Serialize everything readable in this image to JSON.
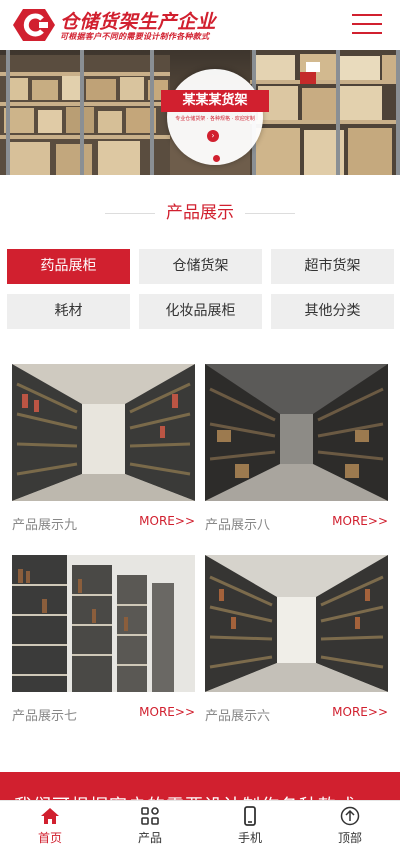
{
  "header": {
    "logo_title": "仓储货架生产企业",
    "logo_subtitle": "可根据客户不同的需要设计制作各种款式",
    "menu_icon": "hamburger-menu-icon"
  },
  "banner": {
    "title": "某某某货架",
    "tagline": "专业仓储货架 · 各种规格 · 欢迎定制",
    "arrow_icon": "chevron-right-circle-icon"
  },
  "section": {
    "title": "产品展示"
  },
  "categories": [
    {
      "label": "药品展柜",
      "active": true
    },
    {
      "label": "仓储货架",
      "active": false
    },
    {
      "label": "超市货架",
      "active": false
    },
    {
      "label": "耗材",
      "active": false
    },
    {
      "label": "化妆品展柜",
      "active": false
    },
    {
      "label": "其他分类",
      "active": false
    }
  ],
  "products": [
    {
      "name": "产品展示九",
      "more": "MORE>>"
    },
    {
      "name": "产品展示八",
      "more": "MORE>>"
    },
    {
      "name": "产品展示七",
      "more": "MORE>>"
    },
    {
      "name": "产品展示六",
      "more": "MORE>>"
    }
  ],
  "strip": {
    "text": "我们可根据客户的需要设计制作各种款式"
  },
  "nav": [
    {
      "label": "首页",
      "icon": "home-icon",
      "active": true
    },
    {
      "label": "产品",
      "icon": "grid-icon",
      "active": false
    },
    {
      "label": "手机",
      "icon": "phone-icon",
      "active": false
    },
    {
      "label": "顶部",
      "icon": "arrow-up-icon",
      "active": false
    }
  ],
  "colors": {
    "accent": "#d1202f",
    "button_bg": "#eeeeee"
  }
}
